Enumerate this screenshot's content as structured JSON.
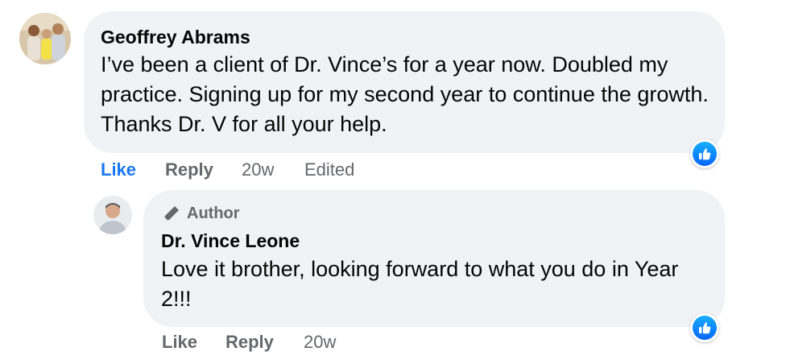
{
  "comment": {
    "author": "Geoffrey Abrams",
    "text": "I’ve been a client of Dr. Vince’s for a year now. Doubled my practice. Signing up for my second year to continue the growth. Thanks Dr. V for all your help.",
    "actions": {
      "like": "Like",
      "reply": "Reply",
      "time": "20w",
      "edited": "Edited"
    },
    "liked": true,
    "reaction_icon": "thumbs-up-icon",
    "avatar_icon": "family-photo-avatar"
  },
  "reply": {
    "badge_icon": "pen-icon",
    "badge": "Author",
    "author": "Dr. Vince Leone",
    "text": "Love it brother, looking forward to what you do in Year 2!!!",
    "actions": {
      "like": "Like",
      "reply": "Reply",
      "time": "20w"
    },
    "liked": false,
    "reaction_icon": "thumbs-up-icon",
    "avatar_icon": "profile-photo-avatar"
  },
  "colors": {
    "bubble": "#f0f2f5",
    "like_active": "#1877f2",
    "meta_text": "#65676b",
    "reaction_blue": "#0866ff"
  }
}
